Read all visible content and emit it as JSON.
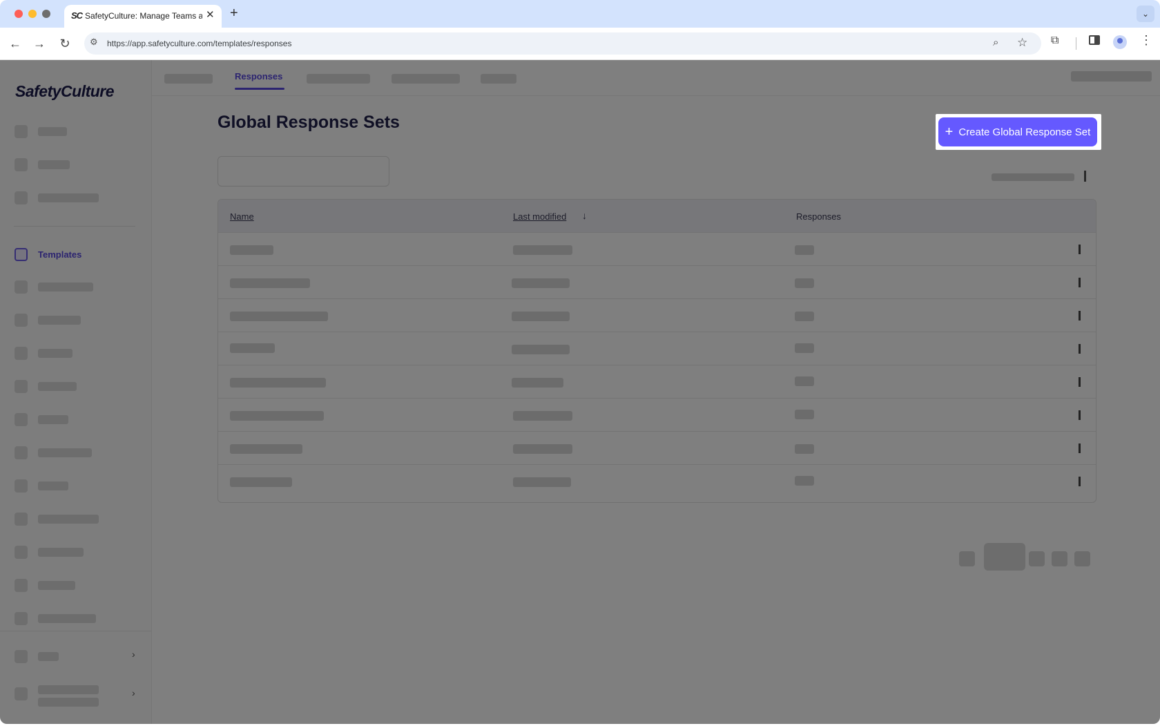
{
  "browser": {
    "tab_favicon": "SC",
    "tab_title": "SafetyCulture: Manage Teams and...",
    "tab_close": "✕",
    "new_tab": "+",
    "tab_search": "⌄",
    "url": "https://app.safetyculture.com/templates/responses",
    "back": "←",
    "forward": "→",
    "reload": "↻",
    "site_info": "⚙",
    "zoom": "⌕",
    "bookmark": "☆",
    "extensions": "⧉",
    "menu": "⋮"
  },
  "sidebar": {
    "logo": "SafetyCulture",
    "active_item": "Templates"
  },
  "topnav": {
    "active_tab": "Responses"
  },
  "main": {
    "title": "Global Response Sets",
    "create_button": {
      "icon": "+",
      "label": "Create Global Response Set",
      "accent": "#6559ff"
    },
    "table": {
      "columns": [
        "Name",
        "Last modified",
        "Responses"
      ],
      "sort_arrow": "↓"
    }
  }
}
